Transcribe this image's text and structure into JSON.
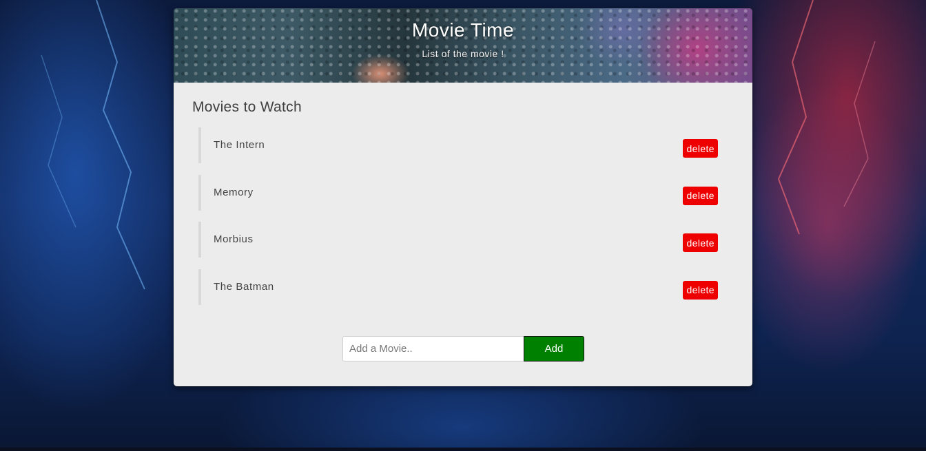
{
  "header": {
    "title": "Movie Time",
    "subtitle": "List of the movie !"
  },
  "main": {
    "section_title": "Movies to Watch",
    "movies": [
      {
        "name": "The Intern",
        "delete_label": "delete"
      },
      {
        "name": "Memory",
        "delete_label": "delete"
      },
      {
        "name": "Morbius",
        "delete_label": "delete"
      },
      {
        "name": "The Batman",
        "delete_label": "delete"
      }
    ]
  },
  "form": {
    "input_placeholder": "Add a Movie..",
    "input_value": "",
    "add_label": "Add"
  },
  "colors": {
    "delete_button": "#ee0000",
    "add_button": "#008000",
    "card_background": "#ececec"
  }
}
